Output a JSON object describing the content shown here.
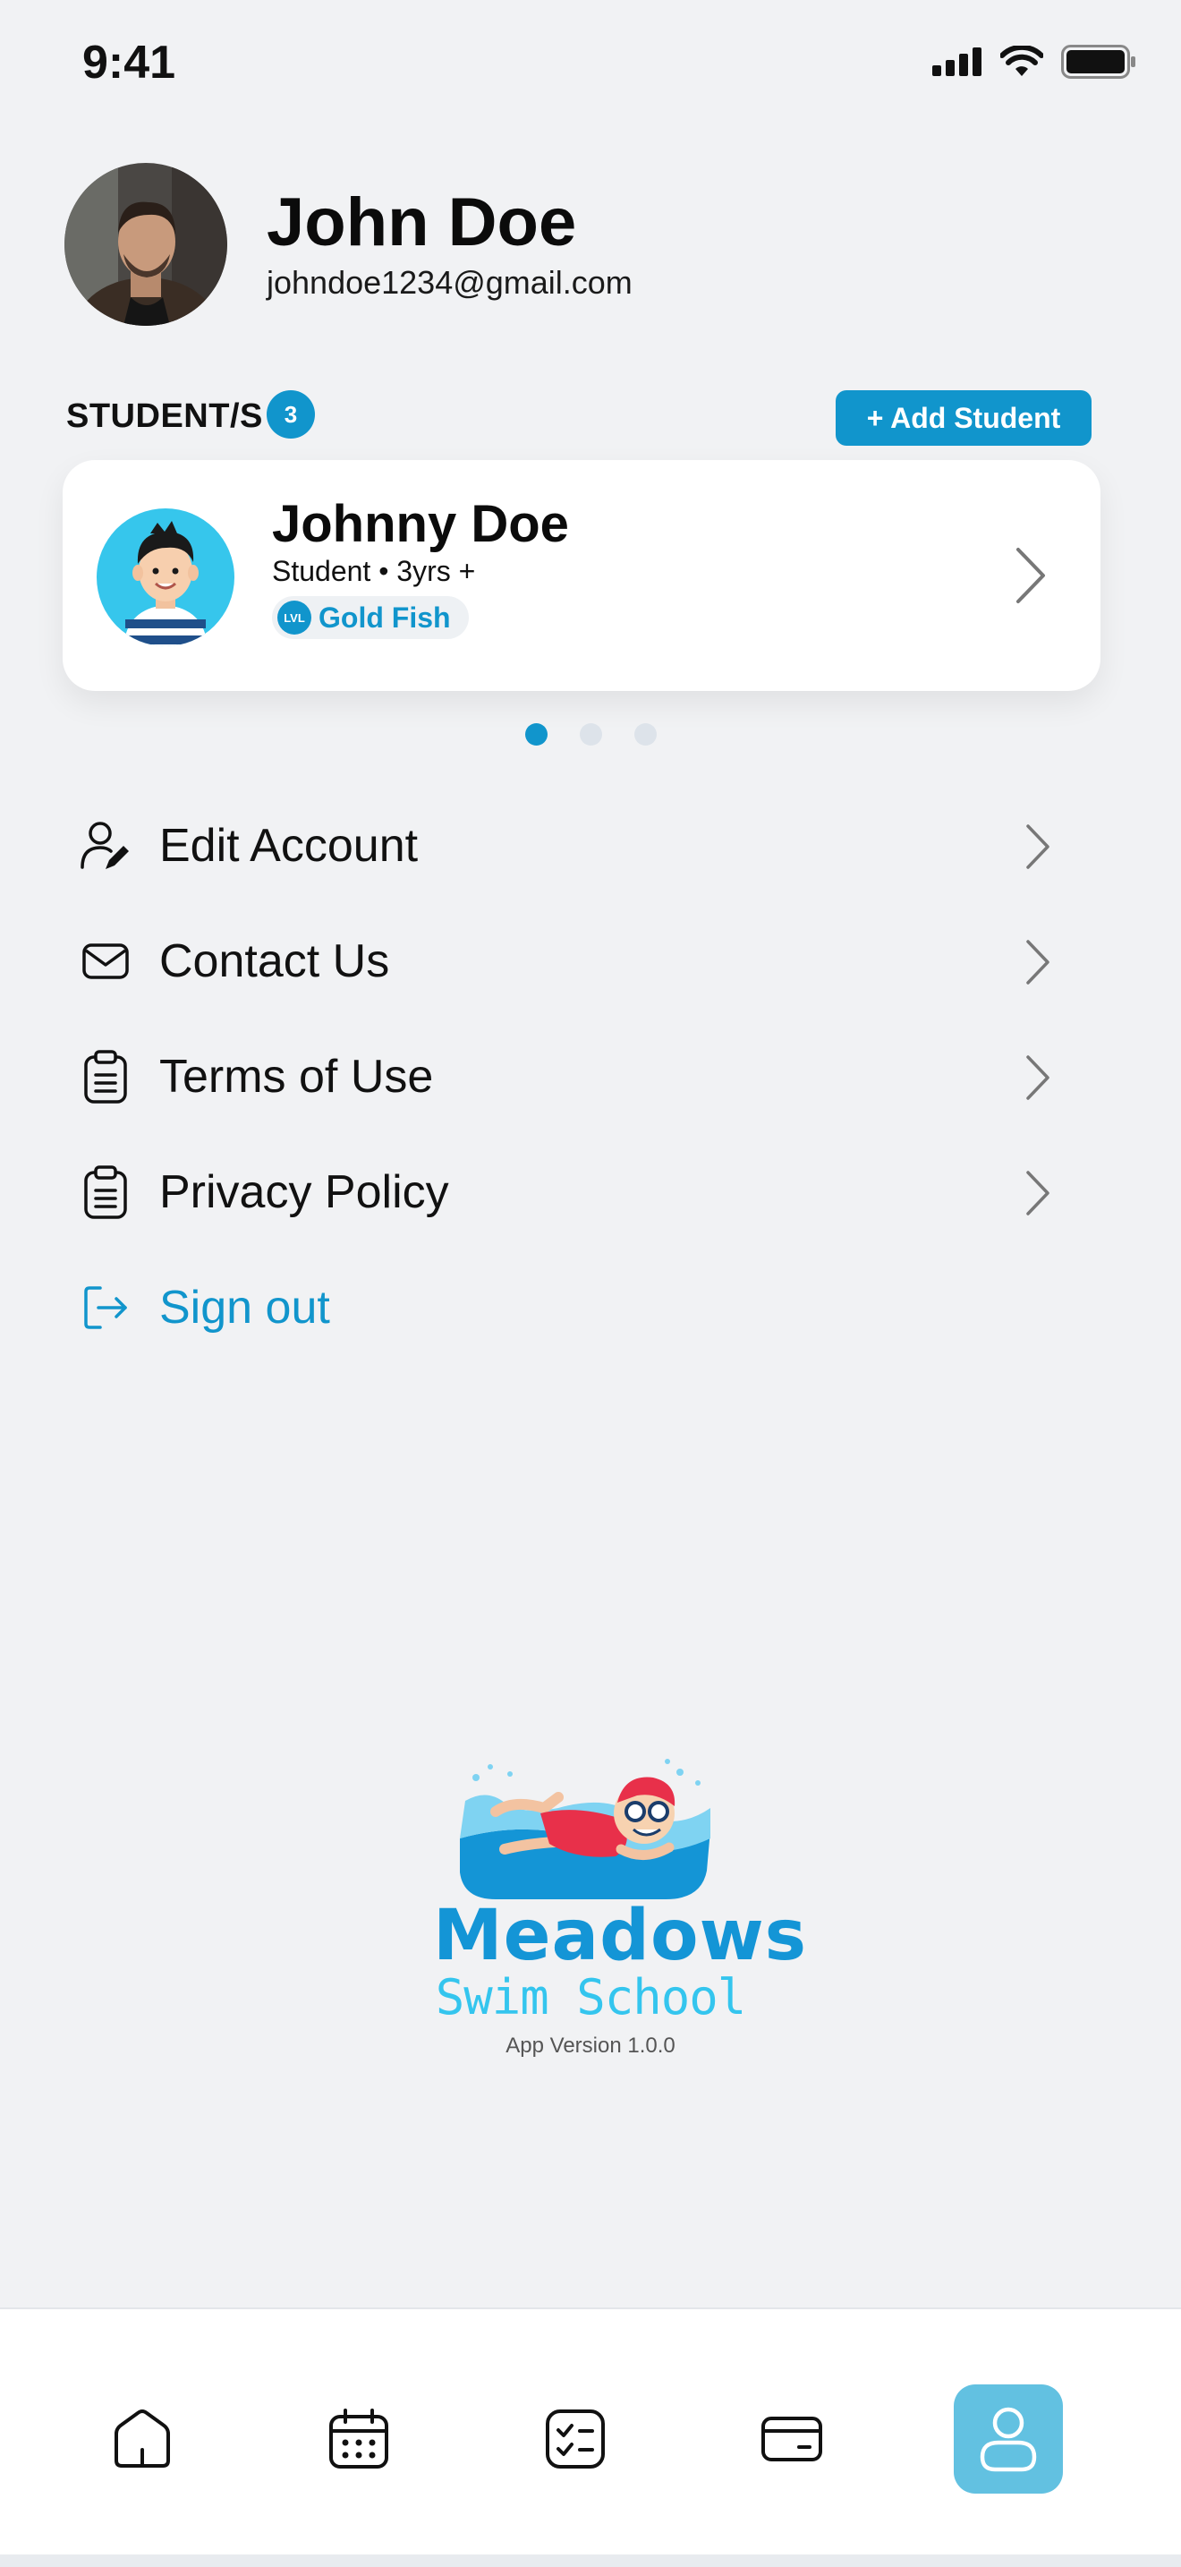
{
  "status_bar": {
    "time": "9:41"
  },
  "profile": {
    "name": "John Doe",
    "email": "johndoe1234@gmail.com"
  },
  "students": {
    "label": "STUDENT/S",
    "count": "3",
    "add_label": "+ Add Student",
    "current": {
      "name": "Johnny Doe",
      "meta": "Student • 3yrs +",
      "level_badge": "LVL",
      "level": "Gold Fish"
    },
    "pager_total": 3,
    "pager_active": 1
  },
  "menu": {
    "items": [
      {
        "label": "Edit Account",
        "icon": "user-edit-icon"
      },
      {
        "label": "Contact Us",
        "icon": "mail-icon"
      },
      {
        "label": "Terms of Use",
        "icon": "clipboard-icon"
      },
      {
        "label": "Privacy Policy",
        "icon": "clipboard-icon"
      }
    ],
    "sign_out": {
      "label": "Sign out",
      "icon": "sign-out-icon"
    }
  },
  "branding": {
    "title": "Meadows",
    "subtitle": "Swim School",
    "app_version": "App Version 1.0.0"
  },
  "bottom_nav": {
    "items": [
      {
        "icon": "home-icon"
      },
      {
        "icon": "calendar-icon"
      },
      {
        "icon": "checklist-icon"
      },
      {
        "icon": "card-icon"
      },
      {
        "icon": "profile-icon",
        "active": true
      }
    ]
  },
  "colors": {
    "accent": "#1195cc",
    "background": "#f1f2f4",
    "nav_active": "#62c1e1",
    "logo_title": "#1495d6",
    "logo_subtitle": "#34c5ee"
  }
}
